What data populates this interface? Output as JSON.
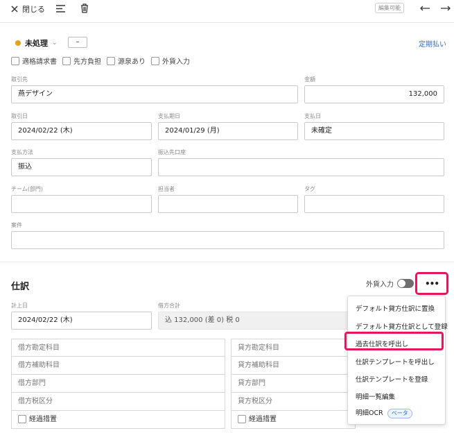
{
  "header": {
    "close_label": "閉じる",
    "editable_badge": "編集可能"
  },
  "status": {
    "label": "未処理",
    "minus_label": "–",
    "recurring_link": "定期払い"
  },
  "checkboxes": [
    "適格請求書",
    "先方負担",
    "源泉あり",
    "外貨入力"
  ],
  "form": {
    "partner": {
      "label": "取引先",
      "value": "燕デザイン"
    },
    "amount": {
      "label": "金額",
      "value": "132,000"
    },
    "date": {
      "label": "取引日",
      "value": "2024/02/22 (木)"
    },
    "due_date": {
      "label": "支払期日",
      "value": "2024/01/29 (月)"
    },
    "paid_date": {
      "label": "支払日",
      "value": "未確定"
    },
    "pay_method": {
      "label": "支払方法",
      "value": "振込"
    },
    "bank": {
      "label": "振込先口座",
      "value": ""
    },
    "team": {
      "label": "チーム(部門)",
      "value": ""
    },
    "person": {
      "label": "担当者",
      "value": ""
    },
    "tag": {
      "label": "タグ",
      "value": ""
    },
    "project": {
      "label": "案件",
      "value": ""
    }
  },
  "journal": {
    "title": "仕訳",
    "foreign_toggle_label": "外貨入力",
    "more_label": "•••",
    "posting_date": {
      "label": "計上日",
      "value": "2024/02/22 (木)"
    },
    "debit_total": {
      "label": "借方合計",
      "value": "込 132,000 (差 0)   税 0"
    },
    "debit_rows": [
      "借方勘定科目",
      "借方補助科目",
      "借方部門",
      "借方税区分",
      "経過措置"
    ],
    "credit_rows": [
      "貸方勘定科目",
      "貸方補助科目",
      "貸方部門",
      "貸方税区分",
      "経過措置"
    ]
  },
  "menu": {
    "items": [
      "デフォルト貸方仕訳に置換",
      "デフォルト貸方仕訳として登録",
      "過去仕訳を呼出し",
      "仕訳テンプレートを呼出し",
      "仕訳テンプレートを登録",
      "明細一覧編集",
      "明細OCR"
    ],
    "beta_badge": "ベータ"
  },
  "icons": {
    "close": "close-icon",
    "list": "list-icon",
    "trash": "trash-icon",
    "prev": "arrow-left-icon",
    "next": "arrow-right-icon"
  },
  "colors": {
    "accent": "#2e6fd1",
    "status_dot": "#e3a21a",
    "highlight": "#e5175a"
  }
}
